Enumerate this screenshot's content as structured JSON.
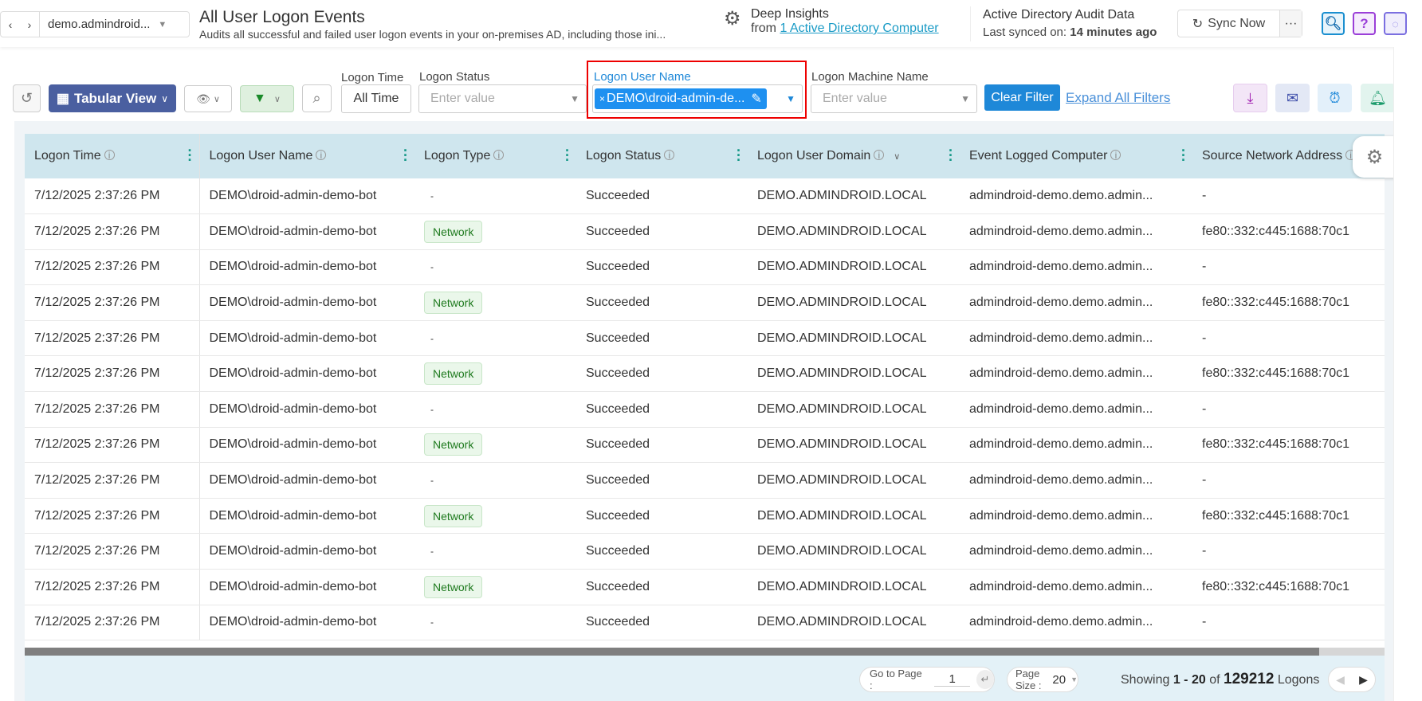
{
  "header": {
    "tenant": "demo.admindroid...",
    "title": "All User Logon Events",
    "subtitle": "Audits all successful and failed user logon events in your on-premises AD, including those ini...",
    "insights_title": "Deep Insights",
    "insights_from": "from",
    "insights_link": "1 Active Directory Computer",
    "audit_title": "Active Directory Audit Data",
    "last_synced_label": "Last synced on:",
    "last_synced_value": "14 minutes ago",
    "sync_label": "Sync Now",
    "more": "···",
    "help": "?"
  },
  "toolbar": {
    "view_label": "Tabular View",
    "filters": [
      {
        "label": "Logon Time",
        "value": "All Time"
      },
      {
        "label": "Logon Status",
        "placeholder": "Enter value"
      },
      {
        "label": "Logon User Name",
        "chip": "DEMO\\droid-admin-de..."
      },
      {
        "label": "Logon Machine Name",
        "placeholder": "Enter value"
      }
    ],
    "clear_filter": "Clear Filter",
    "expand_filters": "Expand All Filters"
  },
  "table": {
    "columns": [
      "Logon Time",
      "Logon User Name",
      "Logon Type",
      "Logon Status",
      "Logon User Domain",
      "Event Logged Computer",
      "Source Network Address"
    ],
    "rows": [
      [
        "7/12/2025 2:37:26 PM",
        "DEMO\\droid-admin-demo-bot",
        "-",
        "Succeeded",
        "DEMO.ADMINDROID.LOCAL",
        "admindroid-demo.demo.admin...",
        "-"
      ],
      [
        "7/12/2025 2:37:26 PM",
        "DEMO\\droid-admin-demo-bot",
        "Network",
        "Succeeded",
        "DEMO.ADMINDROID.LOCAL",
        "admindroid-demo.demo.admin...",
        "fe80::332:c445:1688:70c1"
      ],
      [
        "7/12/2025 2:37:26 PM",
        "DEMO\\droid-admin-demo-bot",
        "-",
        "Succeeded",
        "DEMO.ADMINDROID.LOCAL",
        "admindroid-demo.demo.admin...",
        "-"
      ],
      [
        "7/12/2025 2:37:26 PM",
        "DEMO\\droid-admin-demo-bot",
        "Network",
        "Succeeded",
        "DEMO.ADMINDROID.LOCAL",
        "admindroid-demo.demo.admin...",
        "fe80::332:c445:1688:70c1"
      ],
      [
        "7/12/2025 2:37:26 PM",
        "DEMO\\droid-admin-demo-bot",
        "-",
        "Succeeded",
        "DEMO.ADMINDROID.LOCAL",
        "admindroid-demo.demo.admin...",
        "-"
      ],
      [
        "7/12/2025 2:37:26 PM",
        "DEMO\\droid-admin-demo-bot",
        "Network",
        "Succeeded",
        "DEMO.ADMINDROID.LOCAL",
        "admindroid-demo.demo.admin...",
        "fe80::332:c445:1688:70c1"
      ],
      [
        "7/12/2025 2:37:26 PM",
        "DEMO\\droid-admin-demo-bot",
        "-",
        "Succeeded",
        "DEMO.ADMINDROID.LOCAL",
        "admindroid-demo.demo.admin...",
        "-"
      ],
      [
        "7/12/2025 2:37:26 PM",
        "DEMO\\droid-admin-demo-bot",
        "Network",
        "Succeeded",
        "DEMO.ADMINDROID.LOCAL",
        "admindroid-demo.demo.admin...",
        "fe80::332:c445:1688:70c1"
      ],
      [
        "7/12/2025 2:37:26 PM",
        "DEMO\\droid-admin-demo-bot",
        "-",
        "Succeeded",
        "DEMO.ADMINDROID.LOCAL",
        "admindroid-demo.demo.admin...",
        "-"
      ],
      [
        "7/12/2025 2:37:26 PM",
        "DEMO\\droid-admin-demo-bot",
        "Network",
        "Succeeded",
        "DEMO.ADMINDROID.LOCAL",
        "admindroid-demo.demo.admin...",
        "fe80::332:c445:1688:70c1"
      ],
      [
        "7/12/2025 2:37:26 PM",
        "DEMO\\droid-admin-demo-bot",
        "-",
        "Succeeded",
        "DEMO.ADMINDROID.LOCAL",
        "admindroid-demo.demo.admin...",
        "-"
      ],
      [
        "7/12/2025 2:37:26 PM",
        "DEMO\\droid-admin-demo-bot",
        "Network",
        "Succeeded",
        "DEMO.ADMINDROID.LOCAL",
        "admindroid-demo.demo.admin...",
        "fe80::332:c445:1688:70c1"
      ],
      [
        "7/12/2025 2:37:26 PM",
        "DEMO\\droid-admin-demo-bot",
        "-",
        "Succeeded",
        "DEMO.ADMINDROID.LOCAL",
        "admindroid-demo.demo.admin...",
        "-"
      ]
    ]
  },
  "footer": {
    "goto_label": "Go to Page :",
    "goto_value": "1",
    "page_size_label": "Page Size :",
    "page_size": "20",
    "showing": "Showing",
    "range": "1 - 20",
    "of": "of",
    "total": "129212",
    "unit": "Logons"
  }
}
